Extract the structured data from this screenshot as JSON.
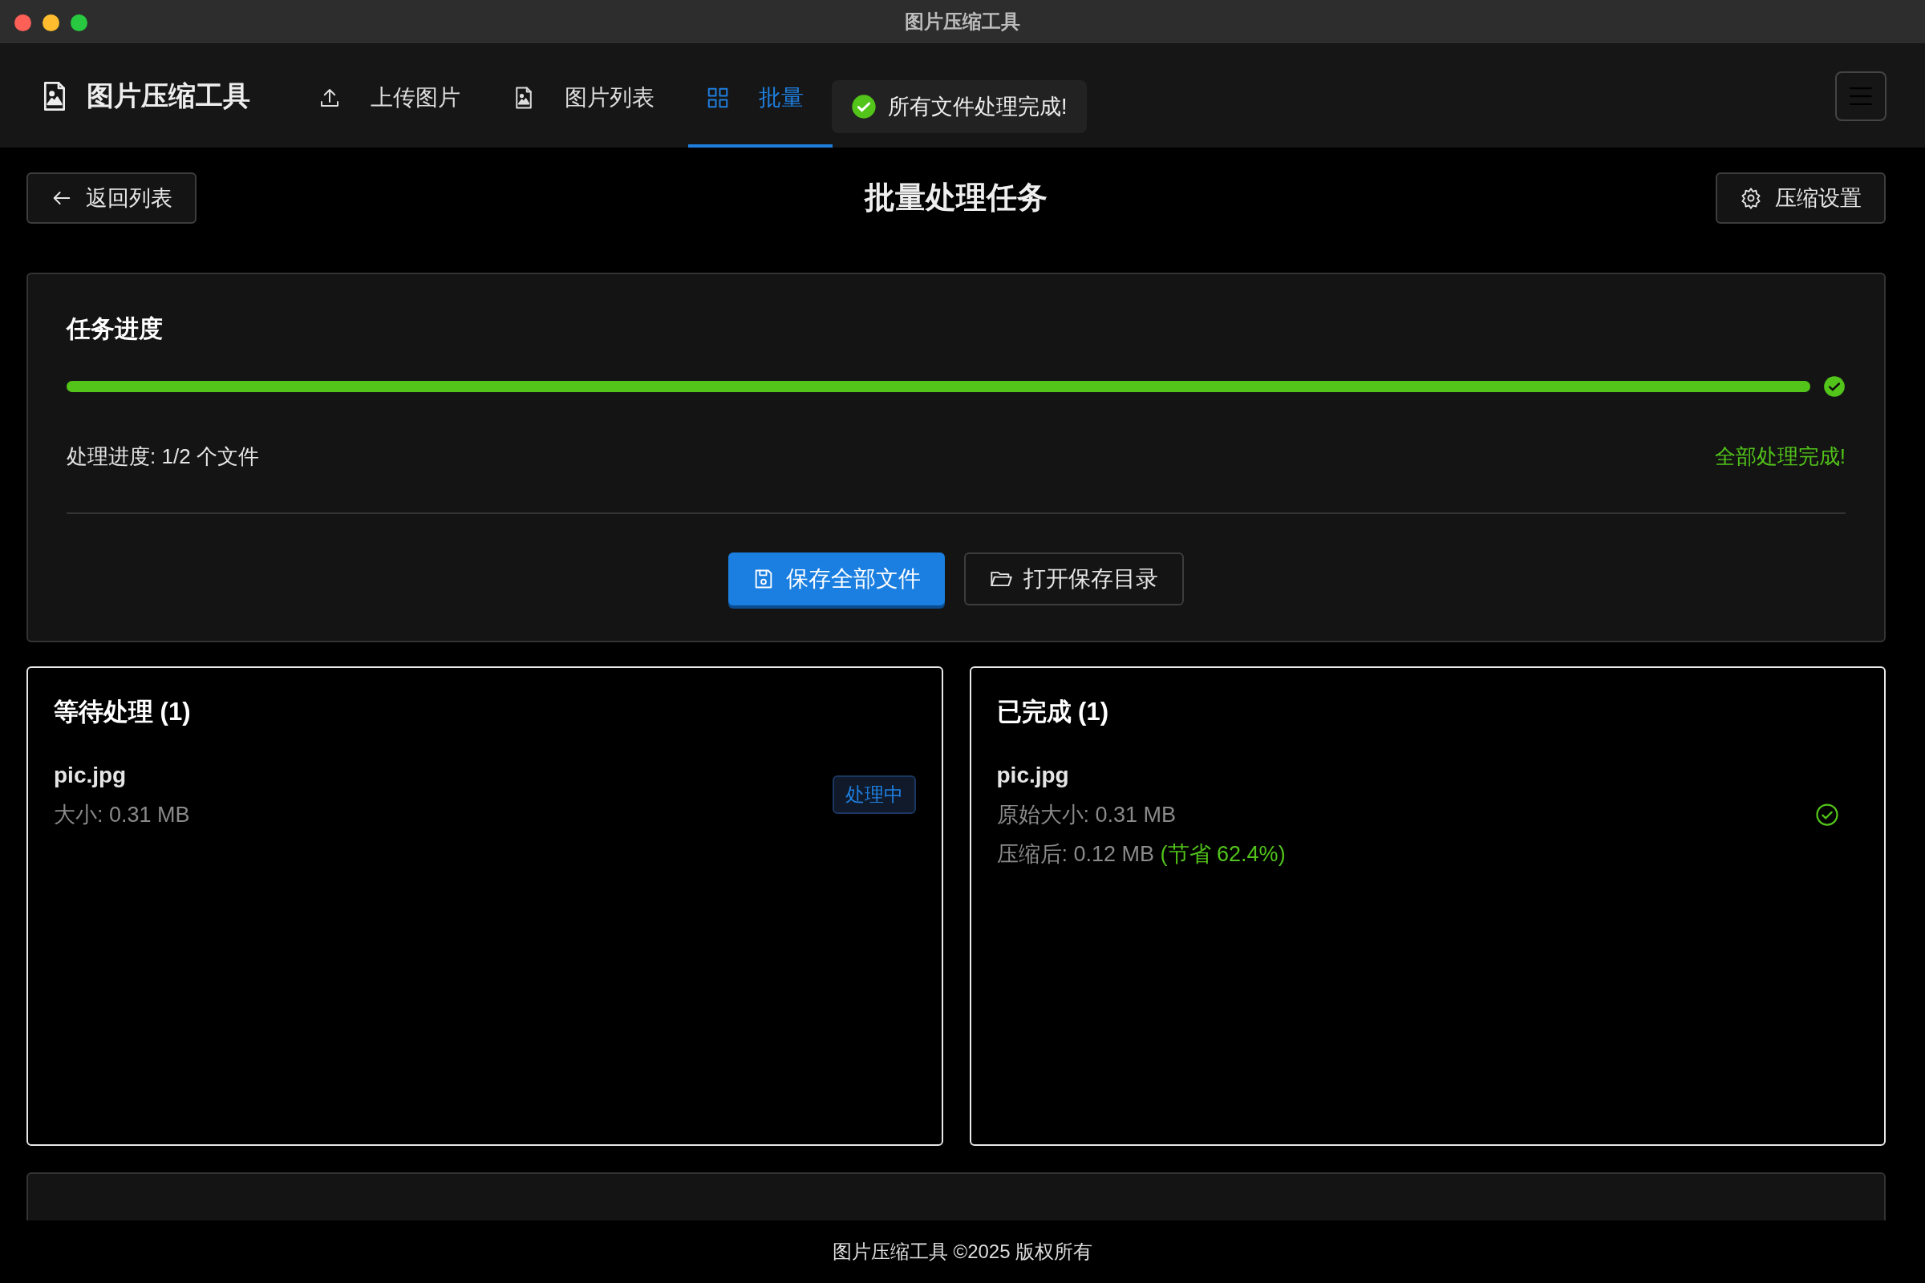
{
  "window": {
    "title": "图片压缩工具"
  },
  "navbar": {
    "brand": "图片压缩工具",
    "items": [
      {
        "label": "上传图片",
        "selected": false
      },
      {
        "label": "图片列表",
        "selected": false
      },
      {
        "label": "批量",
        "selected": true
      }
    ],
    "toast": "所有文件处理完成!"
  },
  "header": {
    "back": "返回列表",
    "title": "批量处理任务",
    "settings": "压缩设置"
  },
  "progress": {
    "title": "任务进度",
    "level": 1,
    "done": true,
    "count": "处理进度: 1/2 个文件",
    "status": "全部处理完成!",
    "actions": [
      {
        "label": "保存全部文件",
        "kind": "primary"
      },
      {
        "label": "打开保存目录",
        "kind": "secondary"
      }
    ]
  },
  "queues": [
    {
      "title": "等待处理 (1)",
      "kind": "pending",
      "items": [
        {
          "name": "pic.jpg",
          "size": "大小: 0.31 MB",
          "badge": "处理中"
        }
      ]
    },
    {
      "title": "已完成 (1)",
      "kind": "done",
      "items": [
        {
          "name": "pic.jpg",
          "size": "原始大小: 0.31 MB",
          "compressed": "压缩后: 0.12 MB",
          "saving": "(节省 62.4%)"
        }
      ]
    }
  ],
  "footer": "图片压缩工具 ©2025 版权所有"
}
